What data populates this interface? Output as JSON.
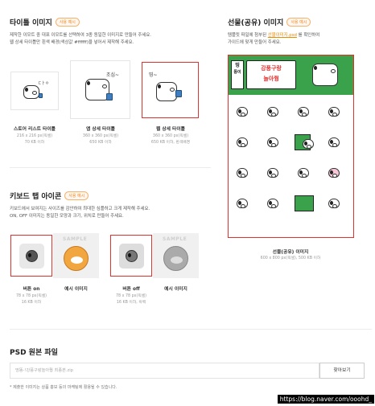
{
  "title_section": {
    "title": "타이틀 이미지",
    "badge": "사용 예시",
    "desc1": "제작한 이모트 중 대표 이모트를 선택하여 3종 동일한 이미지로 만들어 주세요.",
    "desc2": "웹 상세 타이틀만 흰색 배경(색상값 #ffffff)을 넣어서 제작해 주세요.",
    "items": [
      {
        "label": "스토어 리스트 타이틀",
        "size": "216 x 216 px(픽셀)",
        "limit": "70 KB 이하"
      },
      {
        "label": "앱 상세 타이틀",
        "size": "360 x 360 px(픽셀)",
        "limit": "650 KB 이하"
      },
      {
        "label": "웹 상세 타이틀",
        "size": "360 x 360 px(픽셀)",
        "limit": "650 KB 이하, 흰색배경"
      }
    ]
  },
  "share_section": {
    "title": "선물(공유) 이미지",
    "badge": "사용 예시",
    "desc1_pre": "템플릿 파일에 첨부된 ",
    "desc1_link": "선물이미지.psd",
    "desc1_post": " 를 확인하여",
    "desc2": "가이드에 맞게 만들어 주세요.",
    "banner_text1": "띵",
    "banner_text2": "뚱이",
    "banner_text3": "강풍구랑",
    "banner_text4": "놀아줭",
    "caption": "선물(공유) 이미지",
    "size": "600 x 800 px(픽셀), 500 KB 이하"
  },
  "tab_section": {
    "title": "키보드 탭 아이콘",
    "badge": "사용 예시",
    "desc1": "키보드에서 보여지는 사이즈를 감안하여 최대한 심플하고 크게 제작해 주세요.",
    "desc2": "ON, OFF 이미지는 동일한 모양과 크기, 위치로 만들어 주세요.",
    "sample": "SAMPLE",
    "items": [
      {
        "label": "버튼 on",
        "size": "78 x 78 px(픽셀)",
        "limit": "16 KB 이하"
      },
      {
        "label": "예시 이미지",
        "size": "",
        "limit": ""
      },
      {
        "label": "버튼 off",
        "size": "78 x 78 px(픽셀)",
        "limit": "16 KB 이하, 흑백"
      },
      {
        "label": "예시 이미지",
        "size": "",
        "limit": ""
      }
    ]
  },
  "psd_section": {
    "title": "PSD 원본 파일",
    "file_value": "띵똥-!강풍구랑놀아줭 최종본.zip",
    "browse_label": "찾아보기",
    "footnote": "* 제출한 이미지는 상품 홍보 등의 마케팅에 활용될 수 있습니다."
  },
  "doodles": {
    "note_title": "ㄷㅏㅇ",
    "note_app": "조심~",
    "note_web": "띵~"
  },
  "watermark": "https://blog.naver.com/ooohd_",
  "colors": {
    "accent": "#f08a24",
    "highlight_border": "#e0312f",
    "banner_green": "#3aa24a"
  }
}
